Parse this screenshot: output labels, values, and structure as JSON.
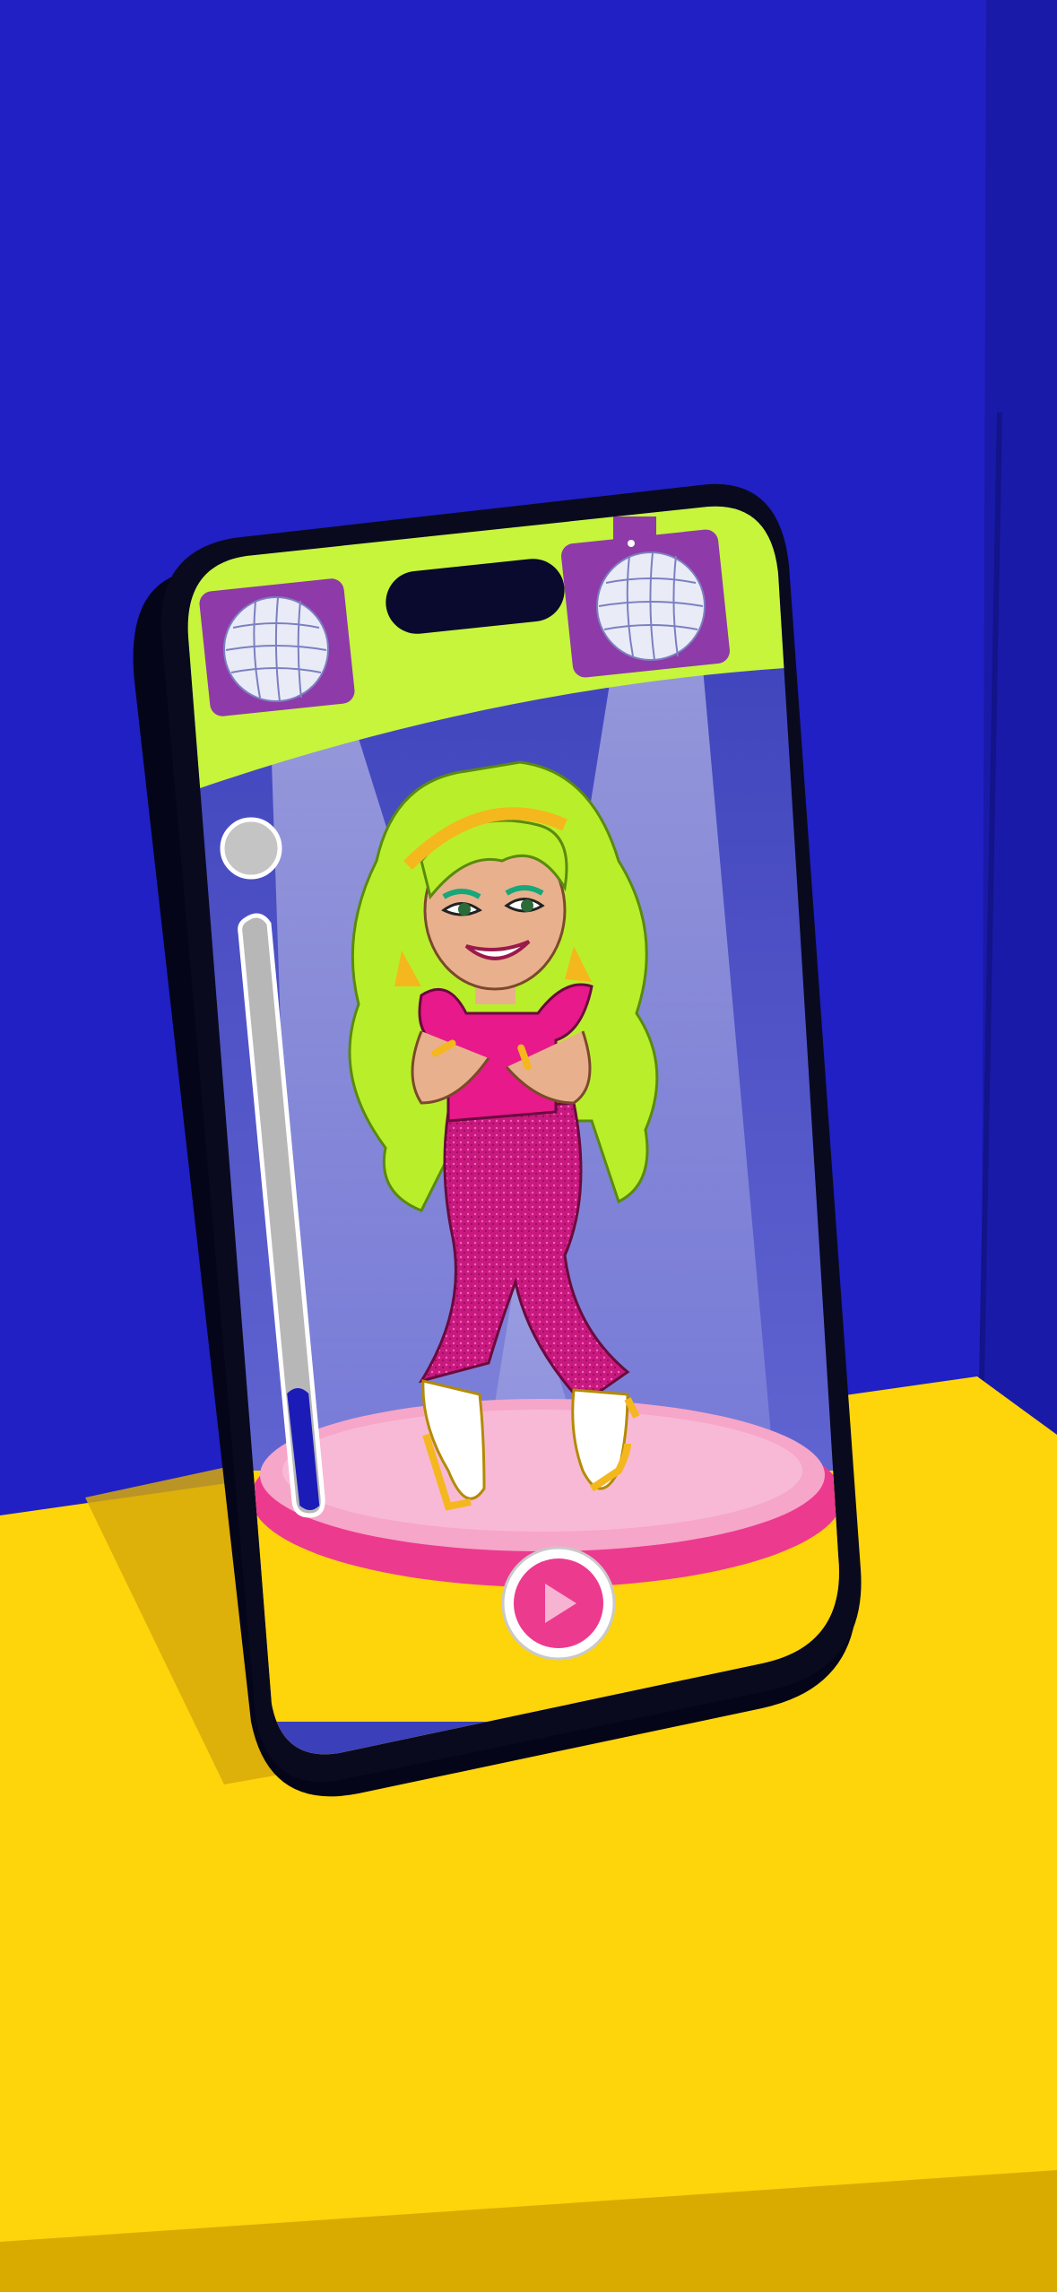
{
  "scene": {
    "wall_color": "#2020c4",
    "floor_color": "#fed40a",
    "phone_frame_color": "#0a0a1e",
    "stage_color": "#ec3a8f",
    "banner_color": "#c6f53c",
    "accent_purple": "#8e3aa8"
  },
  "character": {
    "hair_color": "#b9ef2a",
    "outfit_color": "#d81b87",
    "headband_color": "#f4b71e"
  },
  "controls": {
    "volume_level": 0.2,
    "play_icon": "play-icon",
    "disco_icon": "disco-ball-icon"
  }
}
